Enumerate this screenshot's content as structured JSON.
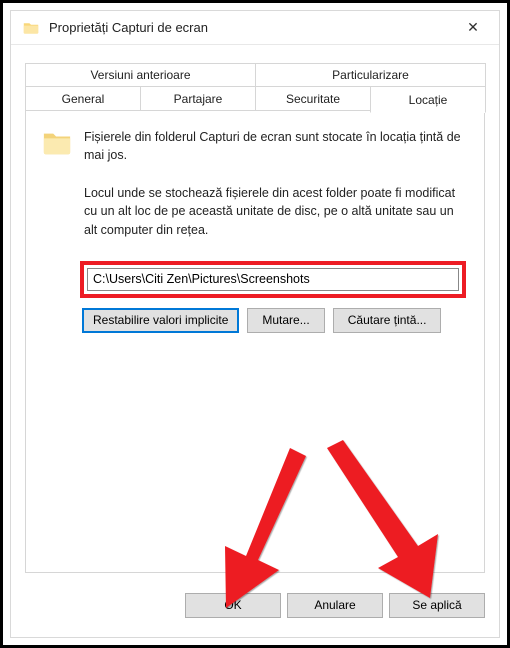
{
  "window": {
    "title": "Proprietăți Capturi de ecran",
    "close_glyph": "✕"
  },
  "tabs": {
    "row1": [
      "Versiuni anterioare",
      "Particularizare"
    ],
    "row2": [
      "General",
      "Partajare",
      "Securitate",
      "Locație"
    ],
    "active": "Locație"
  },
  "body": {
    "header_text": "Fișierele din folderul Capturi de ecran sunt stocate în locația țintă de mai jos.",
    "explain_text": "Locul unde se stochează fișierele din acest folder poate fi modificat cu un alt loc de pe această unitate de disc, pe o altă unitate sau un alt computer din rețea.",
    "path_value": "C:\\Users\\Citi Zen\\Pictures\\Screenshots"
  },
  "buttons": {
    "restore": "Restabilire valori implicite",
    "move": "Mutare...",
    "find": "Căutare țintă..."
  },
  "footer": {
    "ok": "OK",
    "cancel": "Anulare",
    "apply": "Se aplică"
  },
  "colors": {
    "highlight_red": "#ed1c24",
    "button_bg": "#e1e1e1",
    "border": "#adadad",
    "focus": "#0078d7"
  },
  "icons": {
    "folder_small": "folder-icon",
    "folder_large": "folder-icon",
    "close": "close-icon"
  }
}
